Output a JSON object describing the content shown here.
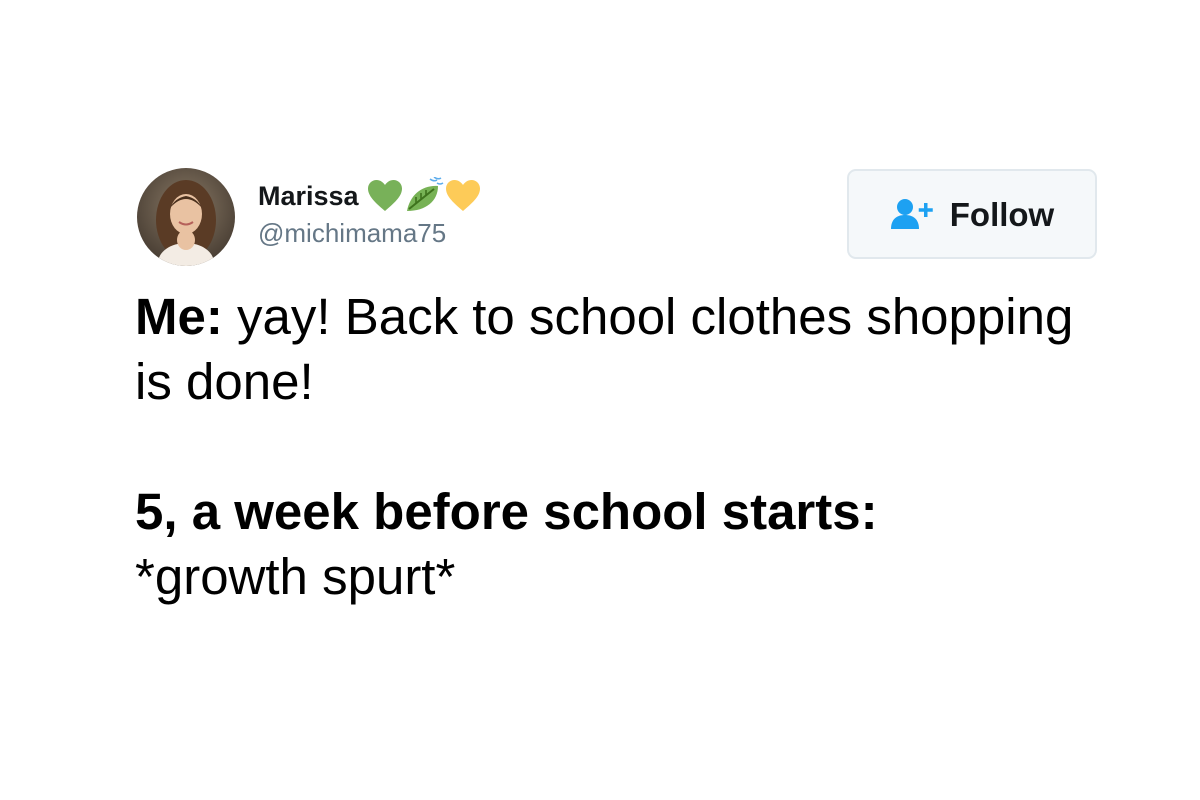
{
  "user": {
    "display_name": "Marissa",
    "name_emojis": [
      "green-heart",
      "leaf-fluttering-in-wind",
      "yellow-heart"
    ],
    "handle": "@michimama75",
    "avatar": "profile-photo"
  },
  "follow_button": {
    "label": "Follow",
    "icon": "add-user-icon"
  },
  "tweet": {
    "line1_bold": "Me:",
    "line1_rest": " yay! Back to school clothes shopping is done!",
    "line2_bold": "5, a week before school starts:",
    "line3": "*growth spurt*"
  },
  "colors": {
    "accent": "#1da1f2",
    "text": "#14171a",
    "handle": "#657786",
    "button_border": "#e1e8ed",
    "button_bg": "#f5f8fa"
  }
}
